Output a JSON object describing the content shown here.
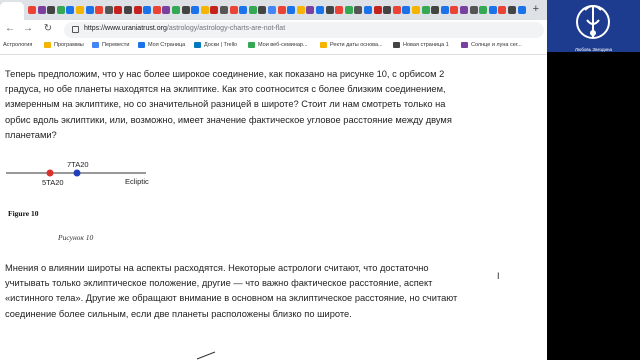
{
  "browser": {
    "url_host": "https://www.uraniatrust.org",
    "url_path": "/astrology/astrology-charts-are-not-flat",
    "tab_favicon_colors": [
      "#ea4335",
      "#7b3fa0",
      "#444",
      "#34a853",
      "#1a73e8",
      "#f4b400",
      "#1a73e8",
      "#ea4335",
      "#555",
      "#c5221f",
      "#444",
      "#c5221f",
      "#1a73e8",
      "#ea4335",
      "#7b3fa0",
      "#34a853",
      "#444",
      "#1a73e8",
      "#f4b400",
      "#c5221f",
      "#555",
      "#ea4335",
      "#1a73e8",
      "#34a853",
      "#444",
      "#4285f4",
      "#ea4335",
      "#1a73e8",
      "#f4b400",
      "#7b3fa0",
      "#1a73e8",
      "#444",
      "#ea4335",
      "#34a853",
      "#555",
      "#1a73e8",
      "#c5221f",
      "#444",
      "#ea4335",
      "#1a73e8",
      "#f4b400",
      "#34a853",
      "#444",
      "#1a73e8",
      "#ea4335",
      "#7b3fa0",
      "#555",
      "#34a853",
      "#1a73e8",
      "#ea4335",
      "#444",
      "#1a73e8"
    ],
    "bookmarks": [
      {
        "label": "Астрология",
        "color": ""
      },
      {
        "label": "Программы",
        "color": "#f4b400"
      },
      {
        "label": "Перевести",
        "color": "#4285f4"
      },
      {
        "label": "Моя Страница",
        "color": "#1a73e8"
      },
      {
        "label": "Доски | Trello",
        "color": "#0079bf"
      },
      {
        "label": "Мои веб-семинар...",
        "color": "#34a853"
      },
      {
        "label": "Ректи даты основа...",
        "color": "#f4b400"
      },
      {
        "label": "Новая страница 1",
        "color": "#444"
      },
      {
        "label": "Солнце и луна сег...",
        "color": "#7b3fa0"
      }
    ]
  },
  "article": {
    "paragraph1": "Теперь предположим, что у нас более широкое соединение, как показано на рисунке 10, с орбисом 2 градуса, но обе планеты находятся на эклиптике. Как это соотносится с более близким соединением, измеренным на эклиптике, но со значительной разницей в широте? Стоит ли нам смотреть только на орбис вдоль эклиптики, или, возможно, имеет значение фактическое угловое расстояние между двумя планетами?",
    "figure": {
      "label_top": "7TA20",
      "label_bottom": "5TA20",
      "label_line": "Ecliptic",
      "caption": "Figure 10",
      "subcaption": "Рисунок 10",
      "colors": {
        "planet1": "#d9302a",
        "planet2": "#1f3fbf",
        "line": "#333333"
      }
    },
    "paragraph2": "Мнения о влиянии широты на аспекты расходятся. Некоторые астрологи считают, что достаточно учитывать только эклиптическое положение, другие — что важно фактическое расстояние, аспект «истинного тела». Другие же обращают внимание в основном на эклиптическое расстояние, но считают соединение более сильным, если две планеты расположены близко по широте."
  },
  "participant": {
    "name": "Любовь Звездина"
  }
}
